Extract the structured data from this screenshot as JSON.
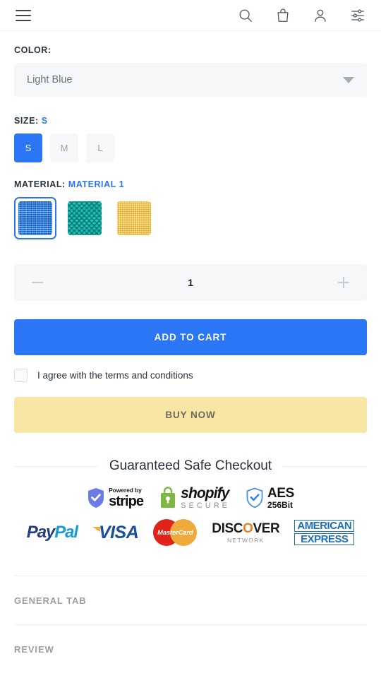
{
  "header": {
    "menu_icon": "hamburger-menu-icon",
    "icons": [
      {
        "name": "search-icon",
        "label": "Search"
      },
      {
        "name": "shopping-bag-icon",
        "label": "Cart"
      },
      {
        "name": "user-account-icon",
        "label": "Account"
      },
      {
        "name": "filter-settings-icon",
        "label": "Settings"
      }
    ]
  },
  "color": {
    "label": "COLOR:",
    "selected": "Light Blue",
    "caret_icon": "chevron-down-icon"
  },
  "size": {
    "label": "SIZE:",
    "selected": "S",
    "options": [
      {
        "label": "S",
        "selected": true
      },
      {
        "label": "M",
        "selected": false
      },
      {
        "label": "L",
        "selected": false
      }
    ]
  },
  "material": {
    "label": "MATERIAL:",
    "selected": "Material 1",
    "options": [
      {
        "name": "material-1",
        "texture": "blue-woven",
        "selected": true
      },
      {
        "name": "material-2",
        "texture": "teal-chevron",
        "selected": false
      },
      {
        "name": "material-3",
        "texture": "yellow-woven",
        "selected": false
      }
    ]
  },
  "quantity": {
    "value": "1",
    "decrease_label": "−",
    "increase_label": "+"
  },
  "actions": {
    "add_to_cart": "ADD TO CART",
    "terms_text": "I agree with the terms and conditions",
    "terms_checked": false,
    "buy_now": "BUY NOW"
  },
  "safe_checkout": {
    "title": "Guaranteed Safe Checkout",
    "badges_row1": [
      {
        "name": "stripe-badge",
        "line1": "Powered by",
        "line2": "stripe"
      },
      {
        "name": "shopify-secure-badge",
        "line1": "shopify",
        "line2": "SECURE"
      },
      {
        "name": "aes-badge",
        "line1": "AES",
        "line2": "256Bit"
      }
    ],
    "badges_row2": [
      {
        "name": "paypal-logo",
        "part1": "Pay",
        "part2": "Pal"
      },
      {
        "name": "visa-logo",
        "text": "VISA"
      },
      {
        "name": "mastercard-logo",
        "text": "MasterCard"
      },
      {
        "name": "discover-logo",
        "line1a": "DISC",
        "line1b": "O",
        "line1c": "VER",
        "line2": "NETWORK"
      },
      {
        "name": "amex-logo",
        "line1": "AMERICAN",
        "line2": "EXPRESS"
      }
    ]
  },
  "tabs": [
    {
      "name": "general-tab",
      "label": "GENERAL TAB"
    },
    {
      "name": "review-tab",
      "label": "REVIEW"
    }
  ],
  "colors": {
    "accent_blue": "#2b76f5",
    "buy_now_yellow": "#f8e6a4",
    "field_gray": "#f6f7f9"
  }
}
